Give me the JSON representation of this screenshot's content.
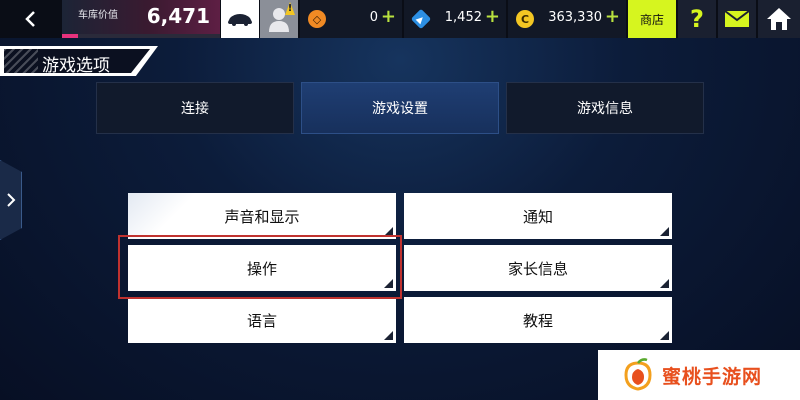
{
  "topbar": {
    "garage_label": "车库价值",
    "garage_value": "6,471",
    "garage_progress": 0.1,
    "currencies": [
      {
        "icon": "coin-token-icon",
        "value": "0",
        "color": "#f08a24"
      },
      {
        "icon": "blueprint-gem-icon",
        "value": "1,452",
        "color": "#2c8fe3"
      },
      {
        "icon": "credits-icon",
        "value": "363,330",
        "color": "#f3c623"
      }
    ],
    "plus_symbol": "+",
    "shop_label": "商店",
    "help_label": "?",
    "avatar_alert": "!"
  },
  "page": {
    "title": "游戏选项"
  },
  "tabs": [
    {
      "label": "连接",
      "active": false
    },
    {
      "label": "游戏设置",
      "active": true
    },
    {
      "label": "游戏信息",
      "active": false
    }
  ],
  "options": [
    {
      "label": "声音和显示"
    },
    {
      "label": "通知"
    },
    {
      "label": "操作"
    },
    {
      "label": "家长信息"
    },
    {
      "label": "语言"
    },
    {
      "label": "教程"
    }
  ],
  "watermark": {
    "text": "蜜桃手游网"
  },
  "colors": {
    "accent_lime": "#d6f51f",
    "garage_pink": "#e8327d",
    "active_tab": "#1f3e73",
    "highlight_red": "#c0322f"
  }
}
